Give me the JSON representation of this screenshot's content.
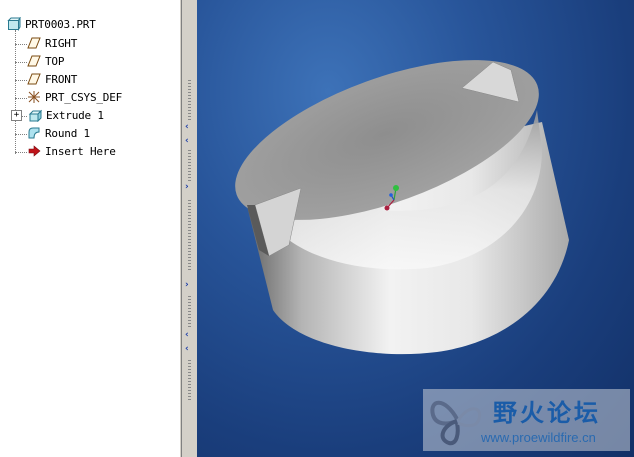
{
  "model_tree": {
    "root": {
      "label": "PRT0003.PRT",
      "icon": "part-icon"
    },
    "items": [
      {
        "label": "RIGHT",
        "icon": "datum-plane-icon"
      },
      {
        "label": "TOP",
        "icon": "datum-plane-icon"
      },
      {
        "label": "FRONT",
        "icon": "datum-plane-icon"
      },
      {
        "label": "PRT_CSYS_DEF",
        "icon": "coordinate-system-icon"
      },
      {
        "label": "Extrude 1",
        "icon": "extrude-icon",
        "expander": "+"
      },
      {
        "label": "Round 1",
        "icon": "round-icon"
      },
      {
        "label": "Insert Here",
        "icon": "insert-arrow-icon"
      }
    ]
  },
  "sash": {
    "collapse_glyph": "‹",
    "expand_glyph": "›"
  },
  "viewport": {
    "colors": {
      "background_top": "#3d72b8",
      "background_bottom": "#123067",
      "model": "#c8c8c8"
    }
  },
  "watermark": {
    "title": "野火论坛",
    "url": "www.proewildfire.cn"
  }
}
